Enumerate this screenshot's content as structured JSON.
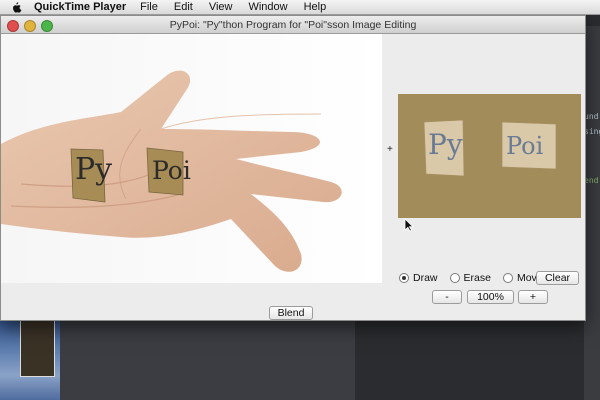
{
  "menubar": {
    "app_name": "QuickTime Player",
    "items": [
      "File",
      "Edit",
      "View",
      "Window",
      "Help"
    ]
  },
  "window": {
    "title": "PyPoi: \"Py\"thon Program for \"Poi\"sson Image Editing",
    "images": {
      "source_label_left": "Py",
      "source_label_right": "Poi",
      "target_label_left": "Py",
      "target_label_right": "Poi"
    },
    "tools": {
      "draw_label": "Draw",
      "erase_label": "Erase",
      "move_label": "Move",
      "selected": "Draw",
      "clear_label": "Clear"
    },
    "zoom": {
      "minus_label": "-",
      "value_label": "100%",
      "plus_label": "+"
    },
    "blend_label": "Blend"
  },
  "background": {
    "editor_fragments": [
      "und",
      "sing",
      "end"
    ]
  }
}
